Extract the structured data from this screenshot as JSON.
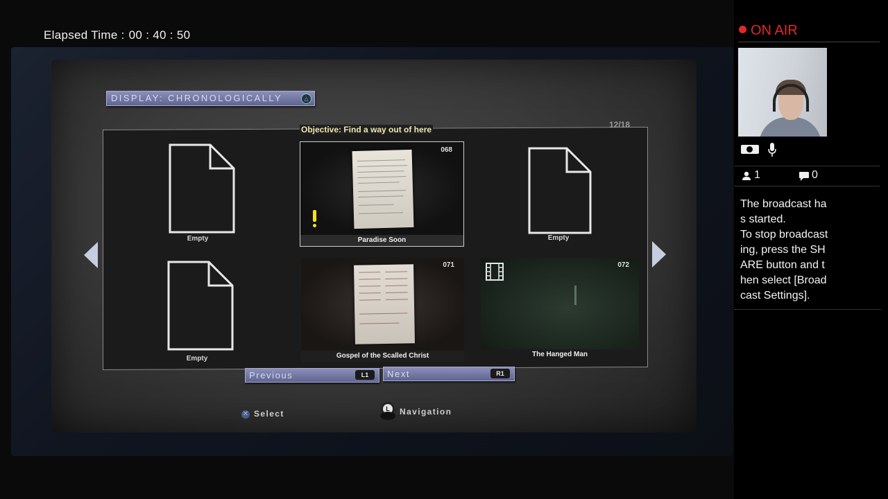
{
  "stream": {
    "elapsed_label": "Elapsed Time :",
    "elapsed_value": "00 : 40 : 50",
    "on_air": "ON AIR",
    "viewers": "1",
    "comments": "0",
    "message": "The broadcast ha\ns started.\nTo stop broadcast\ning, press the SH\nARE button and t\nhen select [Broad\ncast Settings]."
  },
  "game": {
    "display_mode": "DISPLAY: CHRONOLOGICALLY",
    "objective": "Objective: Find a way out of here",
    "page_count": "12/18",
    "slots": [
      {
        "label": "Empty"
      },
      {
        "label": "Paradise Soon",
        "number": "068"
      },
      {
        "label": "Empty"
      },
      {
        "label": "Empty"
      },
      {
        "label": "Gospel of the Scalled Christ",
        "number": "071"
      },
      {
        "label": "The Hanged Man",
        "number": "072"
      }
    ],
    "previous_label": "Previous",
    "previous_key": "L1",
    "next_label": "Next",
    "next_key": "R1",
    "select_hint": "Select",
    "navigation_hint": "Navigation",
    "stick_key": "L"
  },
  "colors": {
    "accent_button": "#6f74a3",
    "on_air_red": "#e0282a",
    "objective_text": "#f0e6b0"
  }
}
